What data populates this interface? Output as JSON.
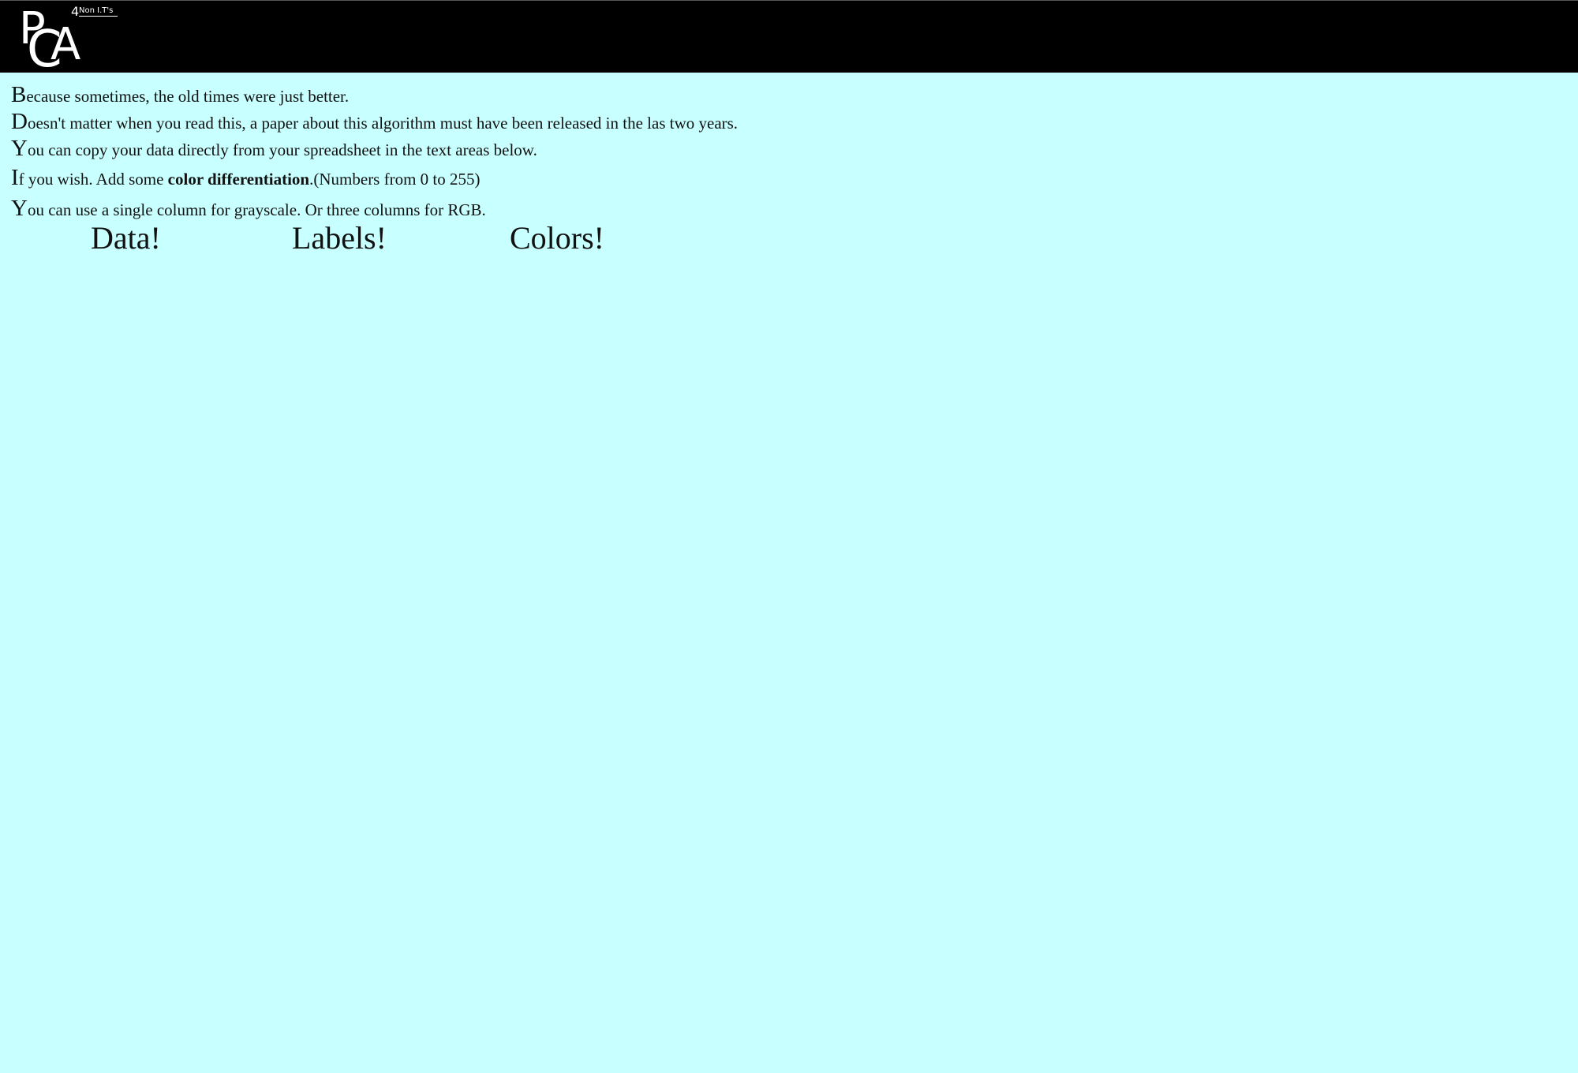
{
  "logo": {
    "letter_p": "P",
    "letter_c": "C",
    "letter_a": "A",
    "number": "4",
    "subtitle": "Non I.T's"
  },
  "intro": {
    "line1_cap": "B",
    "line1_rest": "ecause sometimes, the old times were just better.",
    "line2_cap": "D",
    "line2_rest": "oesn't matter when you read this, a paper about this algorithm must have been released in the las two years.",
    "line3_cap": "Y",
    "line3_rest": "ou can copy your data directly from your spreadsheet in the text areas below.",
    "line4_cap": "I",
    "line4_pre": "f you wish. Add some ",
    "line4_bold": "color differentiation",
    "line4_post": ".(Numbers from 0 to 255)",
    "line5_cap": "Y",
    "line5_rest": "ou can use a single column for grayscale. Or three columns for RGB."
  },
  "columns": {
    "data_label": "Data!",
    "labels_label": "Labels!",
    "colors_label": "Colors!"
  },
  "colors": {
    "background": "#c8ffff",
    "header_background": "#000000",
    "logo_color": "#ffffff"
  }
}
